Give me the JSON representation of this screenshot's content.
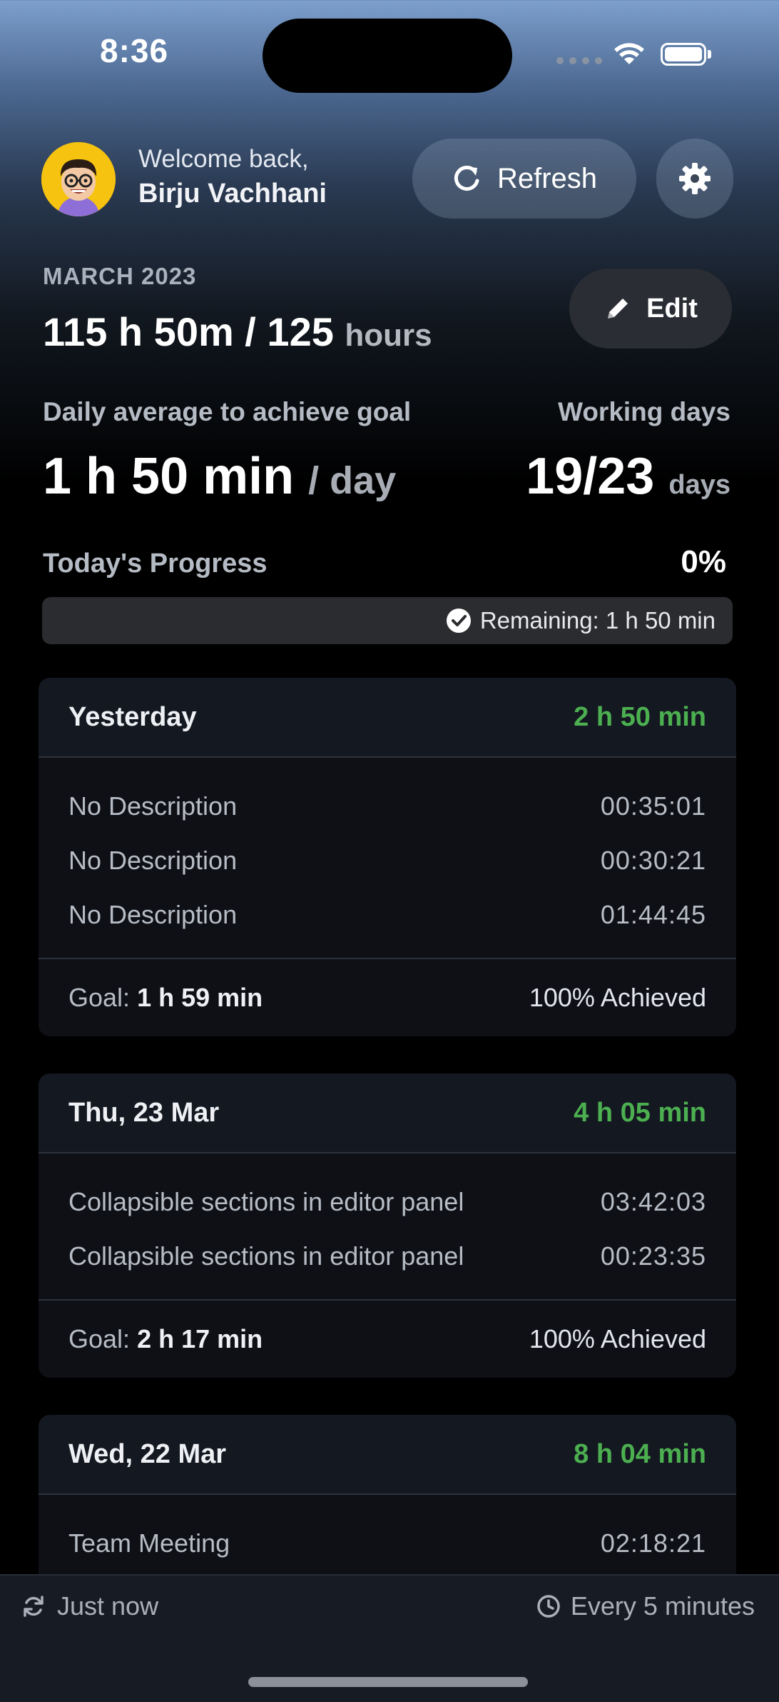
{
  "status_bar": {
    "time": "8:36"
  },
  "header": {
    "welcome": "Welcome back,",
    "username": "Birju Vachhani",
    "refresh_label": "Refresh",
    "edit_label": "Edit"
  },
  "summary": {
    "month": "MARCH 2023",
    "hours_logged": "115 h 50m / 125",
    "hours_unit": "hours",
    "daily_label": "Daily average to achieve goal",
    "daily_value": "1 h 50 min",
    "daily_unit": "/ day",
    "working_label": "Working days",
    "working_value": "19/23",
    "working_unit": "days"
  },
  "today": {
    "label": "Today's Progress",
    "percent": "0%",
    "progress_fraction": 0,
    "remaining": "Remaining: 1 h 50 min"
  },
  "days": [
    {
      "title": "Yesterday",
      "total": "2 h 50 min",
      "entries": [
        {
          "description": "No Description",
          "time": "00:35:01"
        },
        {
          "description": "No Description",
          "time": "00:30:21"
        },
        {
          "description": "No Description",
          "time": "01:44:45"
        }
      ],
      "goal_label": "Goal:",
      "goal_value": "1 h 59 min",
      "achieved": "100% Achieved"
    },
    {
      "title": "Thu, 23 Mar",
      "total": "4 h 05 min",
      "entries": [
        {
          "description": "Collapsible sections in editor panel",
          "time": "03:42:03"
        },
        {
          "description": "Collapsible sections in editor panel",
          "time": "00:23:35"
        }
      ],
      "goal_label": "Goal:",
      "goal_value": "2 h 17 min",
      "achieved": "100% Achieved"
    },
    {
      "title": "Wed, 22 Mar",
      "total": "8 h 04 min",
      "entries": [
        {
          "description": "Team Meeting",
          "time": "02:18:21"
        }
      ]
    }
  ],
  "footer": {
    "last_sync": "Just now",
    "interval": "Every 5 minutes"
  },
  "colors": {
    "accent_green": "#4caf50",
    "avatar_bg": "#f6c311"
  },
  "icons": {
    "refresh": "refresh-icon",
    "settings": "gear-icon",
    "edit": "pencil-icon",
    "check": "check-circle-icon",
    "sync": "sync-icon",
    "clock": "clock-icon"
  }
}
